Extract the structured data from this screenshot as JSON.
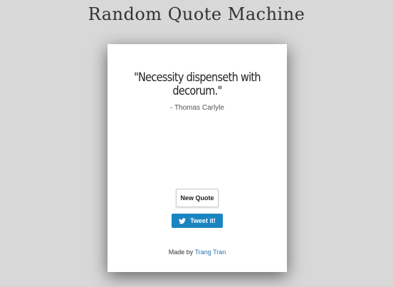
{
  "app_title": "Random Quote Machine",
  "quote": {
    "text": "\"Necessity dispenseth with decorum.\"",
    "author": "- Thomas Carlyle"
  },
  "buttons": {
    "new_quote_label": "New Quote",
    "tweet_label": "Tweet it!"
  },
  "footer": {
    "prefix": "Made by ",
    "author_link": "Trang Tran"
  },
  "colors": {
    "background": "#d8d8d8",
    "card": "#ffffff",
    "tweet_button": "#1a85c0",
    "link": "#2a6fb0"
  },
  "icons": {
    "tweet": "twitter-bird-icon"
  }
}
